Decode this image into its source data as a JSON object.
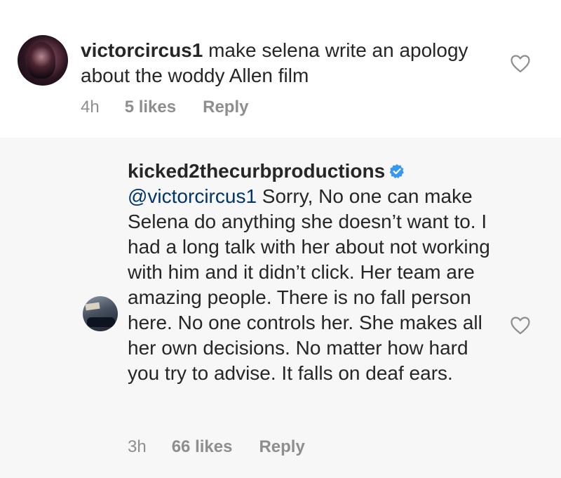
{
  "comments": [
    {
      "username": "victorcircus1",
      "text": "make selena write an apology about the woddy Allen film",
      "time": "4h",
      "likes": "5 likes",
      "reply_label": "Reply",
      "avatar_icon": "user-avatar",
      "like_icon": "heart-outline-icon"
    },
    {
      "username": "kicked2thecurbproductions",
      "verified": true,
      "verified_icon": "verified-badge-icon",
      "mention": "@victorcircus1",
      "text": "Sorry, No one can make Selena do anything she doesn’t want to. I had a long talk with her about not working with him and it didn’t click. Her team are amazing people. There is no fall person here. No one controls her. She makes all her own decisions. No matter how hard you try to advise. It falls on deaf ears.",
      "time": "3h",
      "likes": "66 likes",
      "reply_label": "Reply",
      "avatar_icon": "user-avatar",
      "like_icon": "heart-outline-icon"
    }
  ],
  "colors": {
    "text": "#262626",
    "meta": "#8e8e8e",
    "mention": "#003569",
    "verified": "#3897f0",
    "reply_background": "#f7f7f7"
  }
}
